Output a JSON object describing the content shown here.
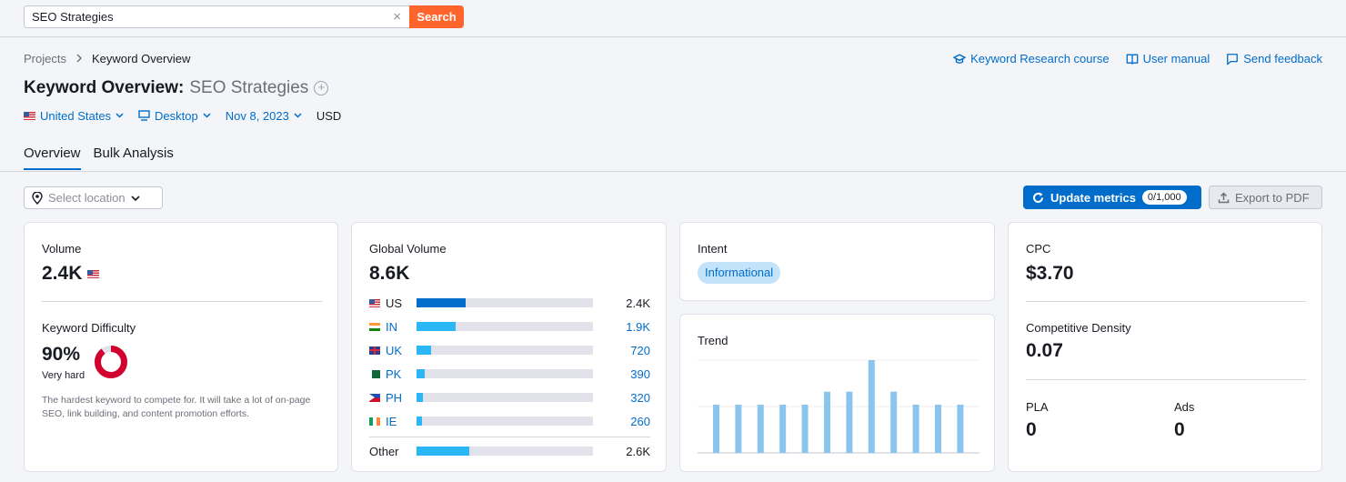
{
  "search": {
    "value": "SEO Strategies",
    "clear_icon": "close-icon",
    "button_label": "Search"
  },
  "breadcrumb": {
    "items": [
      "Projects",
      "Keyword Overview"
    ],
    "separator_icon": "chevron-right-icon"
  },
  "top_links": {
    "course": "Keyword Research course",
    "manual": "User manual",
    "feedback": "Send feedback"
  },
  "header": {
    "title": "Keyword Overview:",
    "keyword": "SEO Strategies"
  },
  "filters": {
    "country": "United States",
    "device": "Desktop",
    "date": "Nov 8, 2023",
    "currency": "USD"
  },
  "tabs": [
    {
      "label": "Overview",
      "active": true
    },
    {
      "label": "Bulk Analysis",
      "active": false
    }
  ],
  "toolbar": {
    "location_placeholder": "Select location",
    "update_label": "Update metrics",
    "update_count": "0/1,000",
    "export_label": "Export to PDF"
  },
  "volume": {
    "label": "Volume",
    "value": "2.4K"
  },
  "difficulty": {
    "label": "Keyword Difficulty",
    "value": "90%",
    "level": "Very hard",
    "percent": 90,
    "color": "#d1002f",
    "description": "The hardest keyword to compete for. It will take a lot of on-page SEO, link building, and content promotion efforts."
  },
  "global_volume": {
    "label": "Global Volume",
    "value": "8.6K",
    "rows": [
      {
        "code": "US",
        "value": "2.4K",
        "fraction": 0.28,
        "color": "#006dca",
        "value_color": "#191b23"
      },
      {
        "code": "IN",
        "value": "1.9K",
        "fraction": 0.22,
        "color": "#2bb7f7",
        "value_color": "#006dca"
      },
      {
        "code": "UK",
        "value": "720",
        "fraction": 0.085,
        "color": "#2bb7f7",
        "value_color": "#006dca"
      },
      {
        "code": "PK",
        "value": "390",
        "fraction": 0.045,
        "color": "#2bb7f7",
        "value_color": "#006dca"
      },
      {
        "code": "PH",
        "value": "320",
        "fraction": 0.037,
        "color": "#2bb7f7",
        "value_color": "#006dca"
      },
      {
        "code": "IE",
        "value": "260",
        "fraction": 0.03,
        "color": "#2bb7f7",
        "value_color": "#006dca"
      }
    ],
    "other": {
      "label": "Other",
      "value": "2.6K",
      "fraction": 0.3,
      "color": "#2bb7f7"
    }
  },
  "intent": {
    "label": "Intent",
    "value": "Informational"
  },
  "trend": {
    "label": "Trend",
    "values": [
      0.52,
      0.52,
      0.52,
      0.52,
      0.52,
      0.66,
      0.66,
      1.0,
      0.66,
      0.52,
      0.52,
      0.52
    ],
    "bar_color": "#8ac5ef"
  },
  "cpc": {
    "label": "CPC",
    "value": "$3.70"
  },
  "competitive_density": {
    "label": "Competitive Density",
    "value": "0.07"
  },
  "pla": {
    "label": "PLA",
    "value": "0"
  },
  "ads": {
    "label": "Ads",
    "value": "0"
  },
  "colors": {
    "accent": "#006dca",
    "search": "#ff642d",
    "difficulty": "#d1002f"
  }
}
